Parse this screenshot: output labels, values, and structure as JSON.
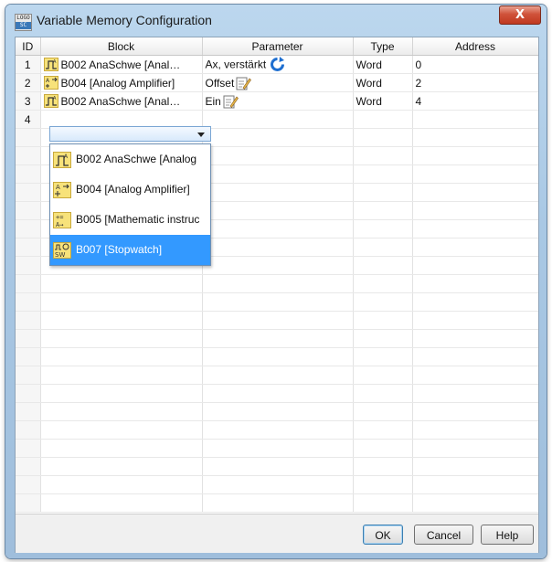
{
  "window": {
    "title": "Variable Memory Configuration",
    "app_icon_top": "LOGO",
    "app_icon_sub": "SC",
    "close_glyph": "X"
  },
  "columns": [
    "ID",
    "Block",
    "Parameter",
    "Type",
    "Address"
  ],
  "rows": [
    {
      "id": "1",
      "block": "B002 AnaSchwe [Anal…",
      "block_icon": "analog-threshold-icon",
      "parameter": "Ax, verstärkt",
      "param_icon": "refresh-icon",
      "type": "Word",
      "address": "0"
    },
    {
      "id": "2",
      "block": "B004 [Analog Amplifier]",
      "block_icon": "analog-amplifier-icon",
      "parameter": "Offset",
      "param_icon": "edit-icon",
      "type": "Word",
      "address": "2"
    },
    {
      "id": "3",
      "block": "B002 AnaSchwe [Anal…",
      "block_icon": "analog-threshold-icon",
      "parameter": "Ein",
      "param_icon": "edit-icon",
      "type": "Word",
      "address": "4"
    },
    {
      "id": "4",
      "block": "",
      "parameter": "",
      "type": "",
      "address": ""
    }
  ],
  "dropdown": {
    "items": [
      {
        "label": "B002 AnaSchwe [Analog",
        "icon": "analog-threshold-icon"
      },
      {
        "label": "B004 [Analog Amplifier]",
        "icon": "analog-amplifier-icon"
      },
      {
        "label": "B005 [Mathematic instruc",
        "icon": "math-instruction-icon"
      },
      {
        "label": "B007 [Stopwatch]",
        "icon": "stopwatch-icon",
        "selected": true
      }
    ]
  },
  "buttons": {
    "ok": "OK",
    "cancel": "Cancel",
    "help": "Help"
  },
  "colors": {
    "selection": "#3399ff",
    "close_button": "#c0391f",
    "icon_yellow": "#f7e27a"
  }
}
